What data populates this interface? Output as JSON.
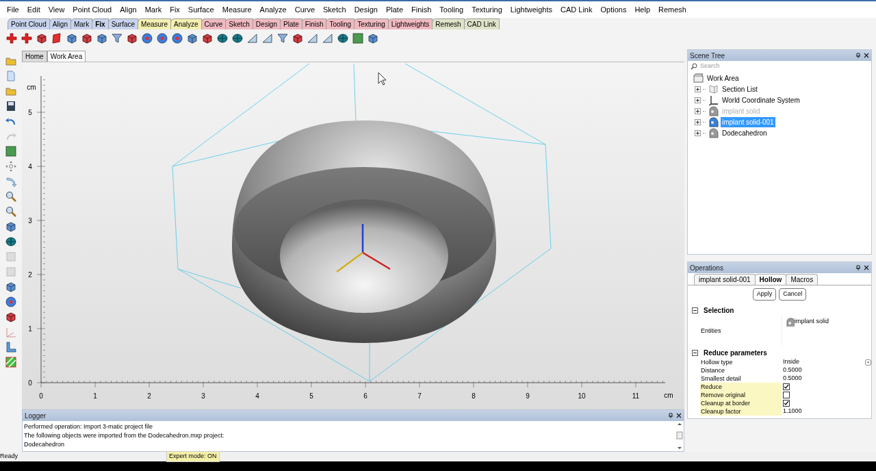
{
  "menu": [
    "File",
    "Edit",
    "View",
    "Point Cloud",
    "Align",
    "Mark",
    "Fix",
    "Surface",
    "Measure",
    "Analyze",
    "Curve",
    "Sketch",
    "Design",
    "Plate",
    "Finish",
    "Tooling",
    "Texturing",
    "Lightweights",
    "CAD Link",
    "Options",
    "Help",
    "Remesh"
  ],
  "ribbon_tabs": [
    {
      "label": "Point Cloud",
      "color": "#c8d4ee",
      "selected": false
    },
    {
      "label": "Align",
      "color": "#c8d4ee",
      "selected": false
    },
    {
      "label": "Mark",
      "color": "#c8d4ee",
      "selected": false
    },
    {
      "label": "Fix",
      "color": "#c8d4ee",
      "selected": true
    },
    {
      "label": "Surface",
      "color": "#c8d4ee",
      "selected": false
    },
    {
      "label": "Measure",
      "color": "#f4efb0",
      "selected": false
    },
    {
      "label": "Analyze",
      "color": "#f4efb0",
      "selected": false
    },
    {
      "label": "Curve",
      "color": "#f0b9c0",
      "selected": false
    },
    {
      "label": "Sketch",
      "color": "#f0b9c0",
      "selected": false
    },
    {
      "label": "Design",
      "color": "#f0b9c0",
      "selected": false
    },
    {
      "label": "Plate",
      "color": "#f0b9c0",
      "selected": false
    },
    {
      "label": "Finish",
      "color": "#f0b9c0",
      "selected": false
    },
    {
      "label": "Tooling",
      "color": "#f0b9c0",
      "selected": false
    },
    {
      "label": "Texturing",
      "color": "#f0b9c0",
      "selected": false
    },
    {
      "label": "Lightweights",
      "color": "#f0b9c0",
      "selected": false
    },
    {
      "label": "Remesh",
      "color": "#dfe3c8",
      "selected": false
    },
    {
      "label": "CAD Link",
      "color": "#dfe3c8",
      "selected": false
    }
  ],
  "view_tabs": [
    {
      "label": "Home",
      "selected": false
    },
    {
      "label": "Work Area",
      "selected": true
    }
  ],
  "viewport": {
    "y_unit": "cm",
    "x_unit": "cm",
    "y_ticks": [
      "5",
      "4",
      "3",
      "2",
      "1",
      "0"
    ],
    "x_ticks": [
      "0",
      "1",
      "2",
      "3",
      "4",
      "5",
      "6",
      "7",
      "8",
      "9",
      "10",
      "11"
    ]
  },
  "scene_tree": {
    "title": "Scene Tree",
    "search_placeholder": "Search",
    "items": [
      {
        "label": "Work Area",
        "children": [
          {
            "label": "Section List",
            "kind": "section",
            "expanded": false,
            "selected": false,
            "disabled": false
          },
          {
            "label": "World Coordinate System",
            "kind": "axes",
            "expanded": false,
            "selected": false,
            "disabled": false
          },
          {
            "label": "implant solid",
            "kind": "part",
            "expanded": false,
            "selected": false,
            "disabled": true
          },
          {
            "label": "implant solid-001",
            "kind": "part",
            "expanded": false,
            "selected": true,
            "disabled": false
          },
          {
            "label": "Dodecahedron",
            "kind": "part",
            "expanded": false,
            "selected": false,
            "disabled": false
          }
        ]
      }
    ]
  },
  "operations": {
    "title": "Operations",
    "tabs": [
      {
        "label": "implant solid-001",
        "selected": false
      },
      {
        "label": "Hollow",
        "selected": true
      },
      {
        "label": "Macros",
        "selected": false
      }
    ],
    "buttons": [
      "Apply",
      "Cancel"
    ],
    "sections": [
      {
        "title": "Selection",
        "expanded": true,
        "rows": [
          {
            "kind": "entity",
            "label": "Entities",
            "value": "implant solid",
            "highlighted": false
          }
        ]
      },
      {
        "title": "Reduce parameters",
        "expanded": true,
        "rows": [
          {
            "kind": "dropdown",
            "label": "Hollow type",
            "value": "Inside",
            "highlighted": false
          },
          {
            "kind": "text",
            "label": "Distance",
            "value": "0.5000",
            "highlighted": false
          },
          {
            "kind": "text",
            "label": "Smallest detail",
            "value": "0.5000",
            "highlighted": false
          },
          {
            "kind": "checkbox",
            "label": "Reduce",
            "checked": true,
            "highlighted": true
          },
          {
            "kind": "checkbox",
            "label": "Remove original",
            "checked": false,
            "highlighted": true
          },
          {
            "kind": "checkbox",
            "label": "Cleanup at border",
            "checked": true,
            "highlighted": true
          },
          {
            "kind": "text",
            "label": "Cleanup factor",
            "value": "1.1000",
            "highlighted": true
          }
        ]
      }
    ]
  },
  "logger": {
    "title": "Logger",
    "lines": [
      "Performed operation: Import 3-matic project file",
      "The following objects were imported from the Dodecahedron.mxp project:",
      "Dodecahedron"
    ]
  },
  "status_bar": {
    "text": "Ready",
    "expert_mode": "Expert mode: ON"
  }
}
